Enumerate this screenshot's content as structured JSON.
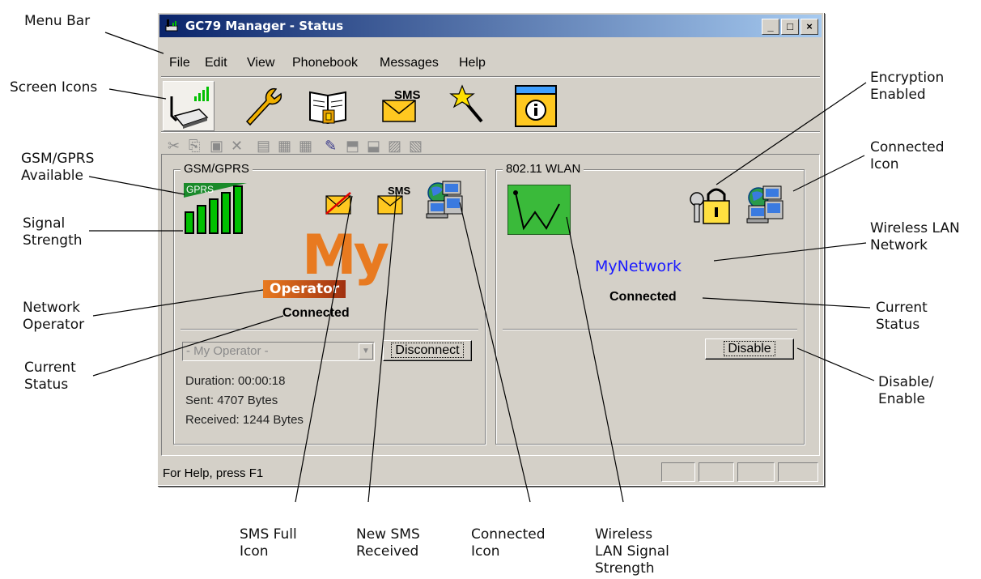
{
  "callouts": {
    "menu_bar": "Menu Bar",
    "screen_icons": "Screen Icons",
    "gsm_gprs_available": "GSM/GPRS\nAvailable",
    "signal_strength": "Signal\nStrength",
    "network_operator": "Network\nOperator",
    "current_status_left": "Current\nStatus",
    "sms_full_icon": "SMS Full\nIcon",
    "new_sms_received": "New SMS\nReceived",
    "connected_icon_bottom": "Connected\nIcon",
    "wireless_lan_signal": "Wireless\nLAN Signal\nStrength",
    "encryption_enabled": "Encryption\nEnabled",
    "connected_icon_right": "Connected\nIcon",
    "wireless_lan_network": "Wireless LAN\nNetwork",
    "current_status_right": "Current\nStatus",
    "disable_enable": "Disable/\nEnable"
  },
  "window": {
    "title": "GC79 Manager - Status",
    "controls": {
      "minimize": "_",
      "maximize": "□",
      "close": "×"
    }
  },
  "menu": {
    "items": [
      "File",
      "Edit",
      "View",
      "Phonebook",
      "Messages",
      "Help"
    ]
  },
  "screen_icons": {
    "sms_label": "SMS"
  },
  "gsm_panel": {
    "label": "GSM/GPRS",
    "gprs_label": "GPRS",
    "signal_bars": 5,
    "sms_label": "SMS",
    "operator_logo_my": "My",
    "operator_logo_operator": "Operator",
    "status": "Connected",
    "operator_select": "- My Operator -",
    "disconnect_label": "Disconnect",
    "duration": "Duration: 00:00:18",
    "sent": "Sent: 4707 Bytes",
    "received": "Received: 1244 Bytes"
  },
  "wlan_panel": {
    "label": "802.11 WLAN",
    "network_name": "MyNetwork",
    "status": "Connected",
    "disable_label": "Disable"
  },
  "status_bar": {
    "help_text": "For Help, press F1"
  },
  "colors": {
    "title_start": "#0a246a",
    "title_end": "#a6caf0",
    "window_bg": "#d4d0c8",
    "signal_green": "#00c000",
    "network_blue": "#1a1aff",
    "operator_orange": "#e87a20"
  }
}
